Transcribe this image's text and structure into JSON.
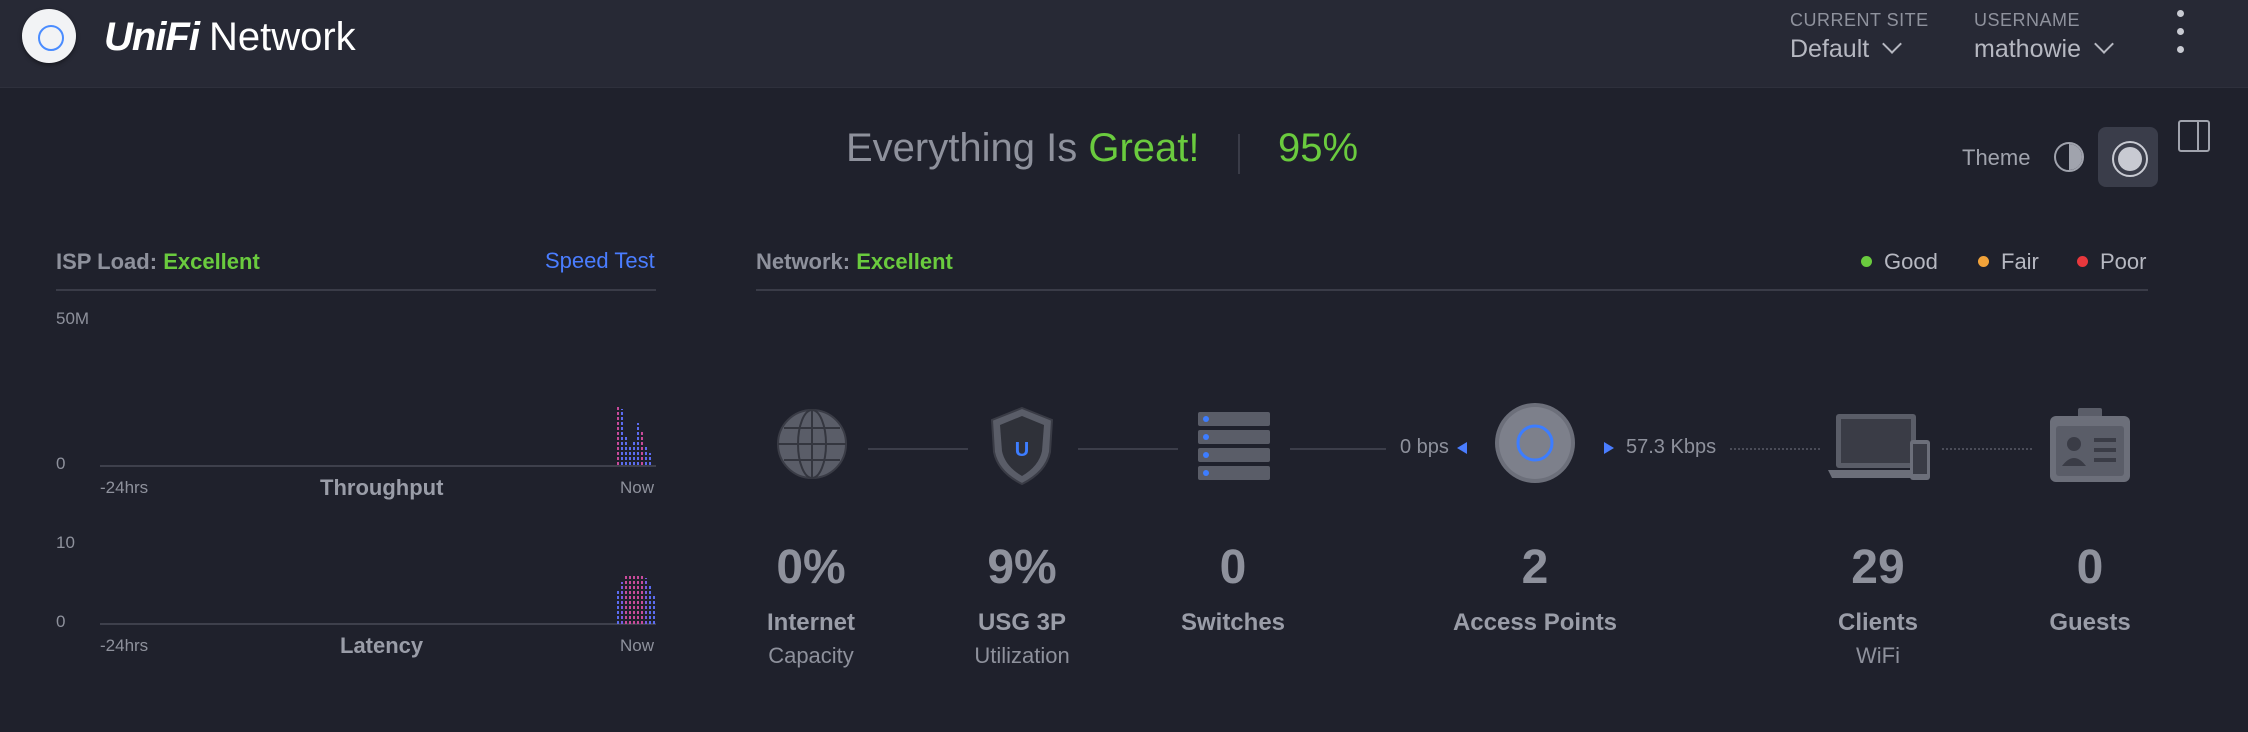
{
  "header": {
    "brand_unifi": "UniFi",
    "brand_network": "Network",
    "current_site_label": "CURRENT SITE",
    "current_site_value": "Default",
    "username_label": "USERNAME",
    "username_value": "mathowie"
  },
  "status": {
    "prefix": "Everything Is ",
    "highlight": "Great!",
    "percent": "95%"
  },
  "theme": {
    "label": "Theme"
  },
  "isp": {
    "label": "ISP Load:",
    "value": "Excellent",
    "speed_test": "Speed Test",
    "throughput": {
      "ymax": "50M",
      "ymin": "0",
      "xstart": "-24hrs",
      "xend": "Now",
      "caption": "Throughput"
    },
    "latency": {
      "ymax": "10",
      "ymin": "0",
      "xstart": "-24hrs",
      "xend": "Now",
      "caption": "Latency"
    }
  },
  "network": {
    "label": "Network:",
    "value": "Excellent",
    "legend": [
      {
        "label": "Good",
        "color": "#6acb3e"
      },
      {
        "label": "Fair",
        "color": "#f2a33a"
      },
      {
        "label": "Poor",
        "color": "#e8383d"
      }
    ],
    "rate_left": "0 bps",
    "rate_right": "57.3 Kbps",
    "stats": [
      {
        "value": "0%",
        "title": "Internet",
        "sub": "Capacity"
      },
      {
        "value": "9%",
        "title": "USG 3P",
        "sub": "Utilization"
      },
      {
        "value": "0",
        "title": "Switches",
        "sub": ""
      },
      {
        "value": "2",
        "title": "Access Points",
        "sub": ""
      },
      {
        "value": "29",
        "title": "Clients",
        "sub": "WiFi"
      },
      {
        "value": "0",
        "title": "Guests",
        "sub": ""
      }
    ]
  },
  "colors": {
    "accent_green": "#6acb3e",
    "accent_blue": "#4a7dff",
    "background": "#1f212c"
  }
}
